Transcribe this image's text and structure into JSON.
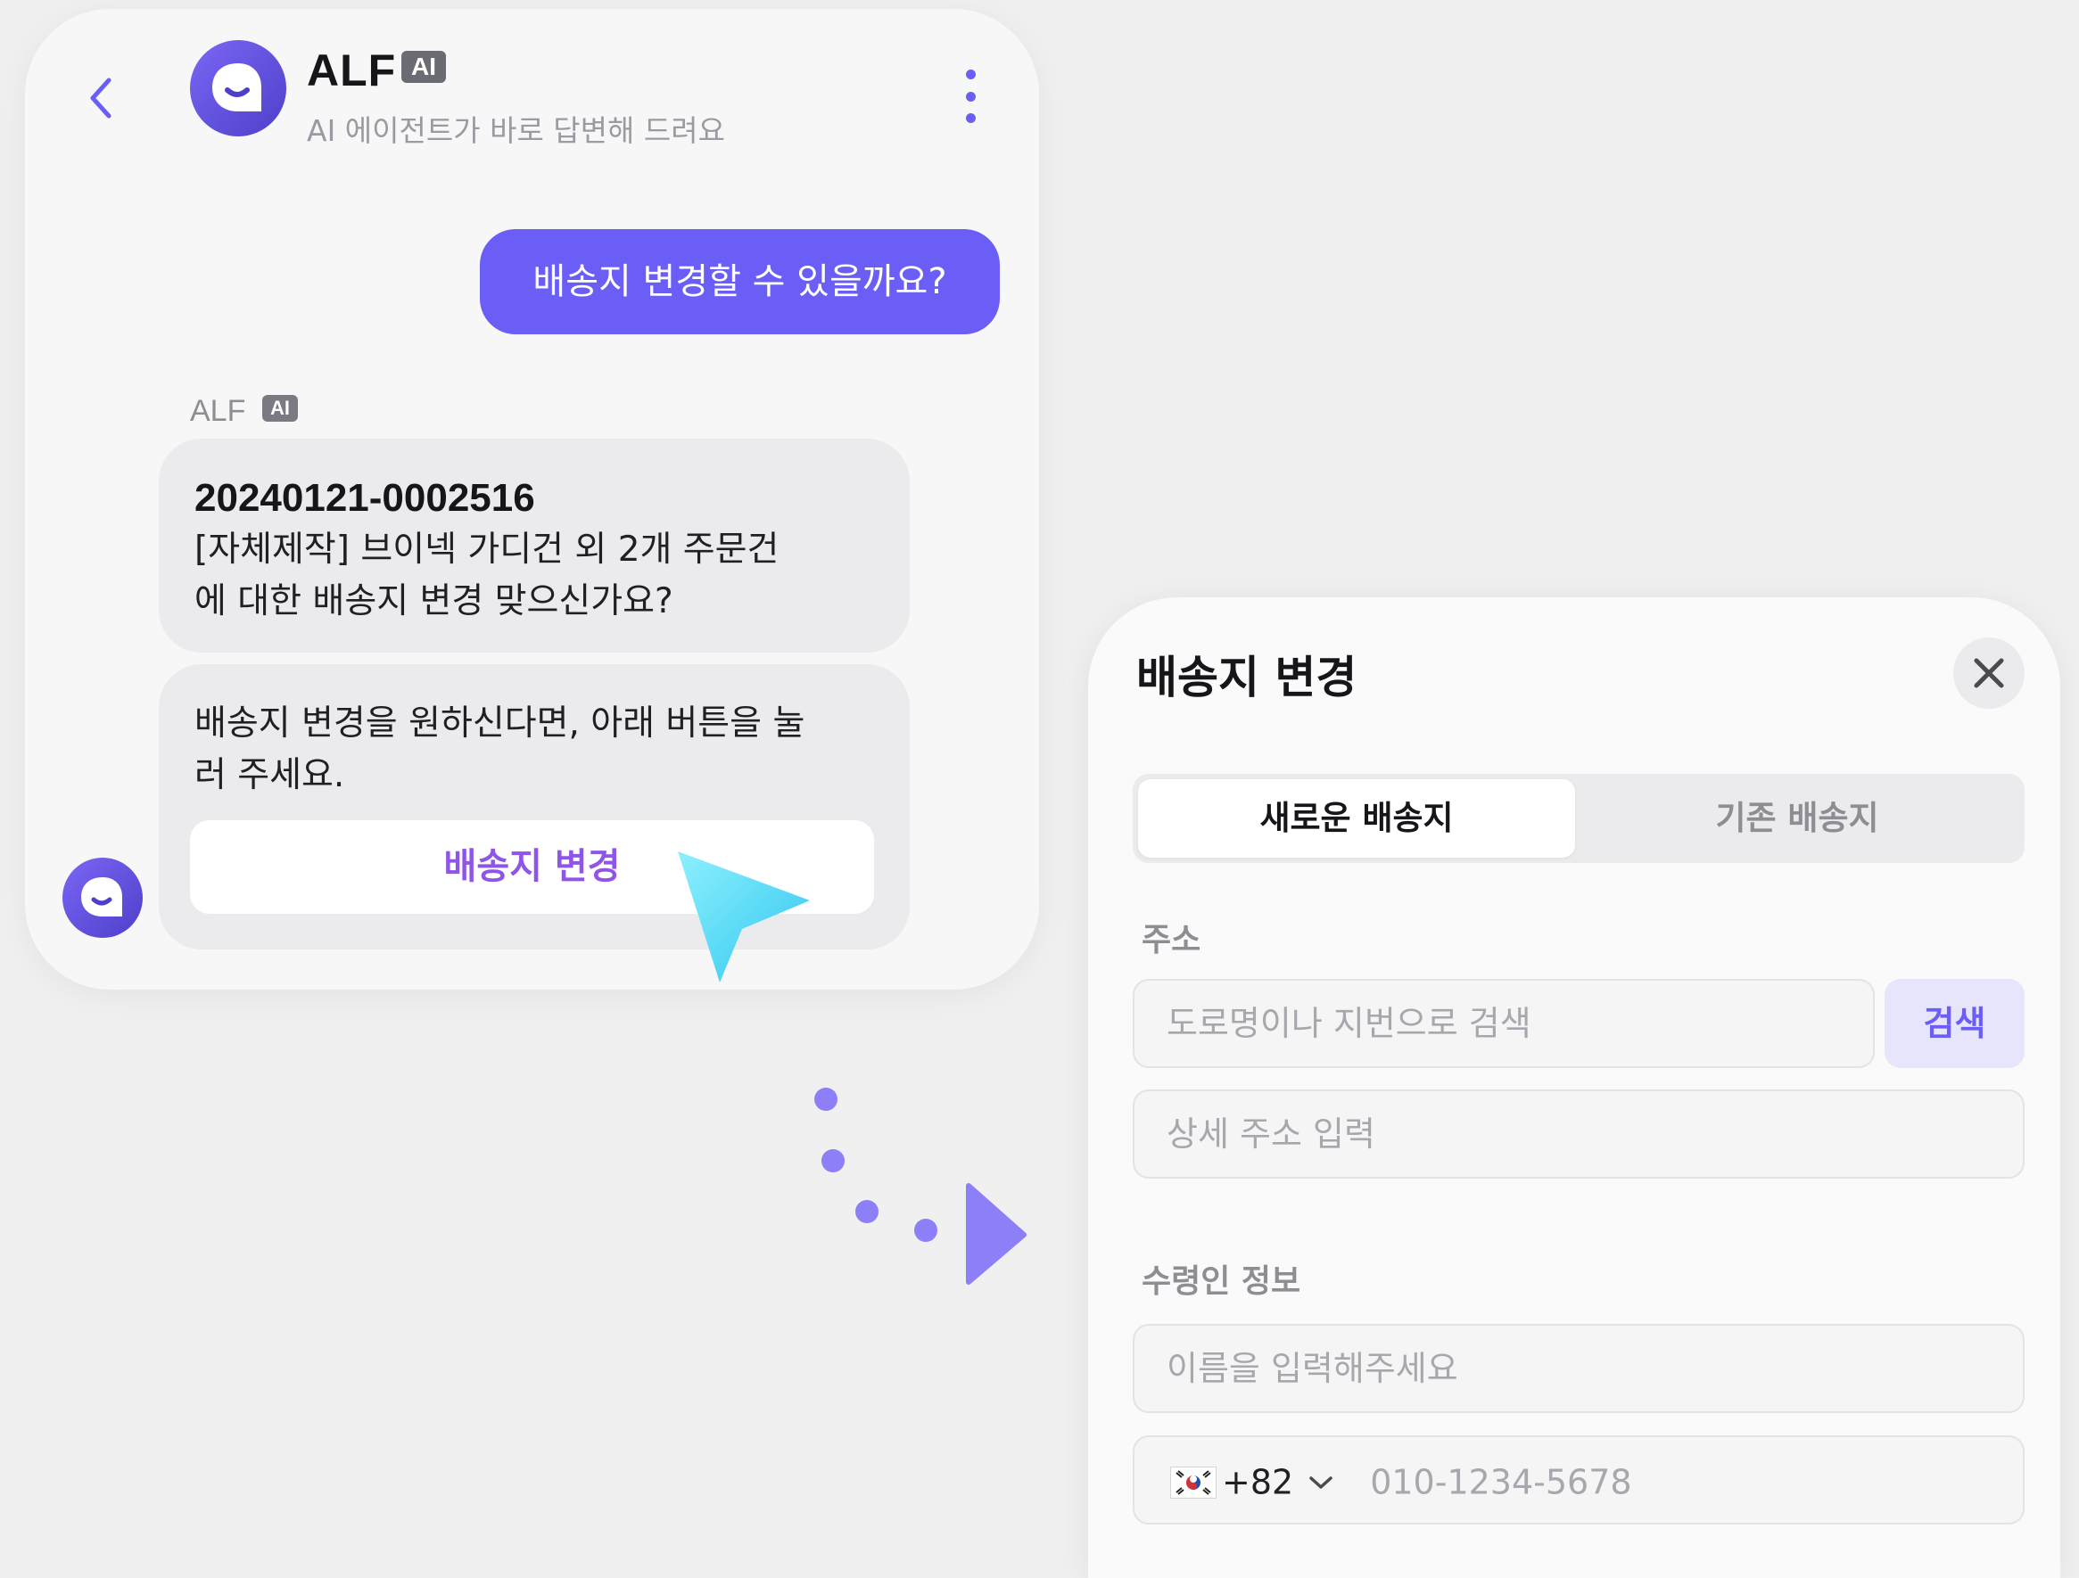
{
  "chat": {
    "app_name": "ALF",
    "ai_badge": "AI",
    "subtitle": "AI 에이전트가 바로 답변해 드려요",
    "user_message": "배송지 변경할 수 있을까요?",
    "bot_label": "ALF",
    "bot_message_1": {
      "order_number": "20240121-0002516",
      "line_1": "[자체제작] 브이넥 가디건 외 2개 주문건",
      "line_2": "에 대한 배송지 변경 맞으신가요?"
    },
    "bot_message_2": {
      "line_1": "배송지 변경을 원하신다면, 아래 버튼을 눌",
      "line_2": "러 주세요.",
      "button_label": "배송지 변경"
    }
  },
  "modal": {
    "title": "배송지 변경",
    "tabs": [
      {
        "label": "새로운 배송지",
        "active": true
      },
      {
        "label": "기존 배송지",
        "active": false
      }
    ],
    "address_label": "주소",
    "search_placeholder": "도로명이나 지번으로 검색",
    "search_button": "검색",
    "detail_placeholder": "상세 주소 입력",
    "recipient_label": "수령인 정보",
    "name_placeholder": "이름을 입력해주세요",
    "phone": {
      "country_code": "+82",
      "placeholder": "010-1234-5678"
    }
  },
  "colors": {
    "accent": "#6b5ef7",
    "button_text": "#8e55e8",
    "cursor": "#4fd8f2",
    "background": "#f0f0f1"
  },
  "icons": [
    "back-chevron-icon",
    "bot-avatar-icon",
    "more-vertical-icon",
    "cursor-pointer-icon",
    "close-icon",
    "korea-flag-icon",
    "chevron-down-icon",
    "flow-arrow-icon"
  ]
}
